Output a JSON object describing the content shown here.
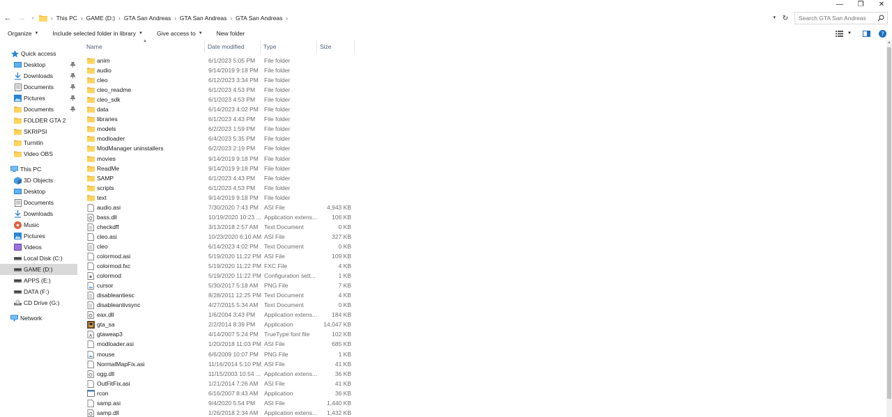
{
  "window": {
    "minimize": "—",
    "restore": "❐",
    "close": "✕"
  },
  "address": {
    "crumbs": [
      "This PC",
      "GAME (D:)",
      "GTA San Andreas",
      "GTA San Andreas",
      "GTA San Andreas"
    ],
    "search_placeholder": "Search GTA San Andreas"
  },
  "commands": {
    "organize": "Organize",
    "include_library": "Include selected folder in library",
    "give_access": "Give access to",
    "new_folder": "New folder"
  },
  "nav": {
    "quick_access": "Quick access",
    "quick_items": [
      "Desktop",
      "Downloads",
      "Documents",
      "Pictures",
      "Documents",
      "FOLDER GTA 2",
      "SKRIPSI",
      "Turnitin",
      "Video OBS"
    ],
    "this_pc": "This PC",
    "pc_items": [
      "3D Objects",
      "Desktop",
      "Documents",
      "Downloads",
      "Music",
      "Pictures",
      "Videos",
      "Local Disk (C:)",
      "GAME (D:)",
      "APPS (E:)",
      "DATA (F:)",
      "CD Drive (G:)"
    ],
    "network": "Network"
  },
  "columns": {
    "name": "Name",
    "date": "Date modified",
    "type": "Type",
    "size": "Size"
  },
  "files": [
    {
      "name": "anim",
      "date": "6/1/2023 5:05 PM",
      "type": "File folder",
      "size": "",
      "icon": "folder"
    },
    {
      "name": "audio",
      "date": "9/14/2019 9:18 PM",
      "type": "File folder",
      "size": "",
      "icon": "folder"
    },
    {
      "name": "cleo",
      "date": "6/12/2023 3:34 PM",
      "type": "File folder",
      "size": "",
      "icon": "folder"
    },
    {
      "name": "cleo_readme",
      "date": "6/1/2023 4:53 PM",
      "type": "File folder",
      "size": "",
      "icon": "folder"
    },
    {
      "name": "cleo_sdk",
      "date": "6/1/2023 4:53 PM",
      "type": "File folder",
      "size": "",
      "icon": "folder"
    },
    {
      "name": "data",
      "date": "6/14/2023 4:02 PM",
      "type": "File folder",
      "size": "",
      "icon": "folder"
    },
    {
      "name": "libraries",
      "date": "6/1/2023 4:43 PM",
      "type": "File folder",
      "size": "",
      "icon": "folder"
    },
    {
      "name": "models",
      "date": "6/2/2023 1:59 PM",
      "type": "File folder",
      "size": "",
      "icon": "folder"
    },
    {
      "name": "modloader",
      "date": "6/4/2023 5:35 PM",
      "type": "File folder",
      "size": "",
      "icon": "folder"
    },
    {
      "name": "ModManager uninstallers",
      "date": "6/2/2023 2:19 PM",
      "type": "File folder",
      "size": "",
      "icon": "folder"
    },
    {
      "name": "movies",
      "date": "9/14/2019 9:18 PM",
      "type": "File folder",
      "size": "",
      "icon": "folder"
    },
    {
      "name": "ReadMe",
      "date": "9/14/2019 9:18 PM",
      "type": "File folder",
      "size": "",
      "icon": "folder"
    },
    {
      "name": "SAMP",
      "date": "6/1/2023 4:43 PM",
      "type": "File folder",
      "size": "",
      "icon": "folder"
    },
    {
      "name": "scripts",
      "date": "6/1/2023 4:53 PM",
      "type": "File folder",
      "size": "",
      "icon": "folder"
    },
    {
      "name": "text",
      "date": "9/14/2019 9:18 PM",
      "type": "File folder",
      "size": "",
      "icon": "folder"
    },
    {
      "name": "audio.asi",
      "date": "7/30/2020 7:43 PM",
      "type": "ASI File",
      "size": "4,943 KB",
      "icon": "file"
    },
    {
      "name": "bass.dll",
      "date": "10/19/2020 10:23 ...",
      "type": "Application extens...",
      "size": "106 KB",
      "icon": "dll"
    },
    {
      "name": "checkdff",
      "date": "3/13/2018 2:57 AM",
      "type": "Text Document",
      "size": "0 KB",
      "icon": "text"
    },
    {
      "name": "cleo.asi",
      "date": "10/23/2020 6:10 AM",
      "type": "ASI File",
      "size": "327 KB",
      "icon": "file"
    },
    {
      "name": "cleo",
      "date": "6/14/2023 4:02 PM",
      "type": "Text Document",
      "size": "0 KB",
      "icon": "text"
    },
    {
      "name": "colormod.asi",
      "date": "5/19/2020 11:22 PM",
      "type": "ASI File",
      "size": "109 KB",
      "icon": "file"
    },
    {
      "name": "colormod.fxc",
      "date": "5/19/2020 11:22 PM",
      "type": "FXC File",
      "size": "4 KB",
      "icon": "file"
    },
    {
      "name": "colormod",
      "date": "5/19/2020 11:22 PM",
      "type": "Configuration sett...",
      "size": "1 KB",
      "icon": "config"
    },
    {
      "name": "cursor",
      "date": "5/30/2017 5:18 AM",
      "type": "PNG File",
      "size": "7 KB",
      "icon": "image"
    },
    {
      "name": "disableantiesc",
      "date": "8/28/2011 12:25 PM",
      "type": "Text Document",
      "size": "4 KB",
      "icon": "text"
    },
    {
      "name": "disableantivsync",
      "date": "4/27/2015 5:34 AM",
      "type": "Text Document",
      "size": "0 KB",
      "icon": "text"
    },
    {
      "name": "eax.dll",
      "date": "1/6/2004 3:43 PM",
      "type": "Application extens...",
      "size": "184 KB",
      "icon": "dll"
    },
    {
      "name": "gta_sa",
      "date": "2/2/2014 8:39 PM",
      "type": "Application",
      "size": "14,047 KB",
      "icon": "exe-game"
    },
    {
      "name": "gtaweap3",
      "date": "4/14/2007 5:24 PM",
      "type": "TrueType font file",
      "size": "102 KB",
      "icon": "font"
    },
    {
      "name": "modloader.asi",
      "date": "1/20/2018 11:03 PM",
      "type": "ASI File",
      "size": "685 KB",
      "icon": "file"
    },
    {
      "name": "mouse",
      "date": "6/6/2009 10:07 PM",
      "type": "PNG File",
      "size": "1 KB",
      "icon": "image"
    },
    {
      "name": "NormalMapFix.asi",
      "date": "11/16/2014 5:10 PM",
      "type": "ASI File",
      "size": "41 KB",
      "icon": "file"
    },
    {
      "name": "ogg.dll",
      "date": "11/15/2003 10:54 ...",
      "type": "Application extens...",
      "size": "36 KB",
      "icon": "dll"
    },
    {
      "name": "OutFitFix.asi",
      "date": "1/21/2014 7:26 AM",
      "type": "ASI File",
      "size": "41 KB",
      "icon": "file"
    },
    {
      "name": "rcon",
      "date": "6/16/2007 8:43 AM",
      "type": "Application",
      "size": "36 KB",
      "icon": "exe"
    },
    {
      "name": "samp.asi",
      "date": "9/4/2020 5:54 PM",
      "type": "ASI File",
      "size": "1,440 KB",
      "icon": "file"
    },
    {
      "name": "samp.dll",
      "date": "1/26/2018 2:34 AM",
      "type": "Application extens...",
      "size": "1,432 KB",
      "icon": "dll"
    }
  ],
  "colors": {
    "folder": "#f5c445",
    "selection": "#d9d9d9",
    "accent": "#0078d7"
  }
}
